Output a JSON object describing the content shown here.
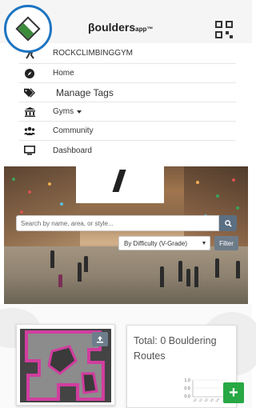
{
  "header": {
    "brand_main": "βoulders",
    "brand_sub": "app™"
  },
  "menu": {
    "gym_name": "ROCKCLIMBINGGYM",
    "items": [
      {
        "label": "Home"
      },
      {
        "label": "Manage Tags"
      },
      {
        "label": "Gyms"
      },
      {
        "label": "Community"
      },
      {
        "label": "Dashboard"
      }
    ]
  },
  "search": {
    "placeholder": "Search by name, area, or style..."
  },
  "sort": {
    "selected": "By Difficulty (V-Grade)"
  },
  "filter_label": "Filter",
  "stats": {
    "title": "Total: 0 Bouldering Routes",
    "chart_ticks": [
      "1.0",
      "0.5",
      "0.0"
    ]
  },
  "fab_label": "+",
  "colors": {
    "accent_ring": "#1d74c2",
    "button_gray": "#5b6f82",
    "fab_green": "#27a844"
  },
  "icons": {
    "logo": "mountain-diamond",
    "qr": "qr-code",
    "gym": "climber",
    "home": "compass",
    "tags": "tags",
    "gyms": "building",
    "community": "users",
    "dashboard": "monitor",
    "search": "search",
    "upload": "upload",
    "add": "plus"
  }
}
